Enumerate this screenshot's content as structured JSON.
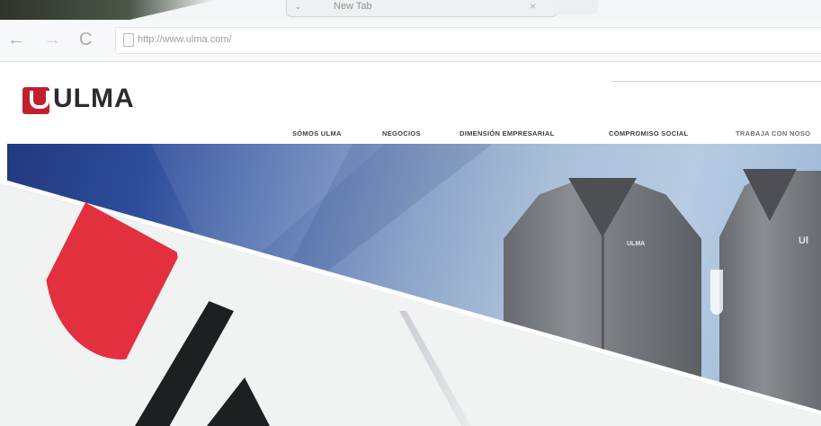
{
  "browser": {
    "tab_title": "New Tab",
    "tab_close": "×",
    "tab_indicator": "⌄",
    "url": "http://www.ulma.com/",
    "back_icon": "←",
    "forward_icon": "→",
    "reload_icon": "C"
  },
  "site": {
    "logo_text": "ULMA",
    "nav": [
      "SÓMOS ULMA",
      "NEGOCIOS",
      "DIMENSIÓN EMPRESARIAL",
      "COMPROMISO SOCIAL",
      "TRABAJA CON NOSO"
    ],
    "jacket_logo": "ULMA",
    "jacket_logo_partial": "Ul",
    "colors": {
      "brand_red": "#c21f2d",
      "hero_blue": "#2d4c9a"
    }
  }
}
